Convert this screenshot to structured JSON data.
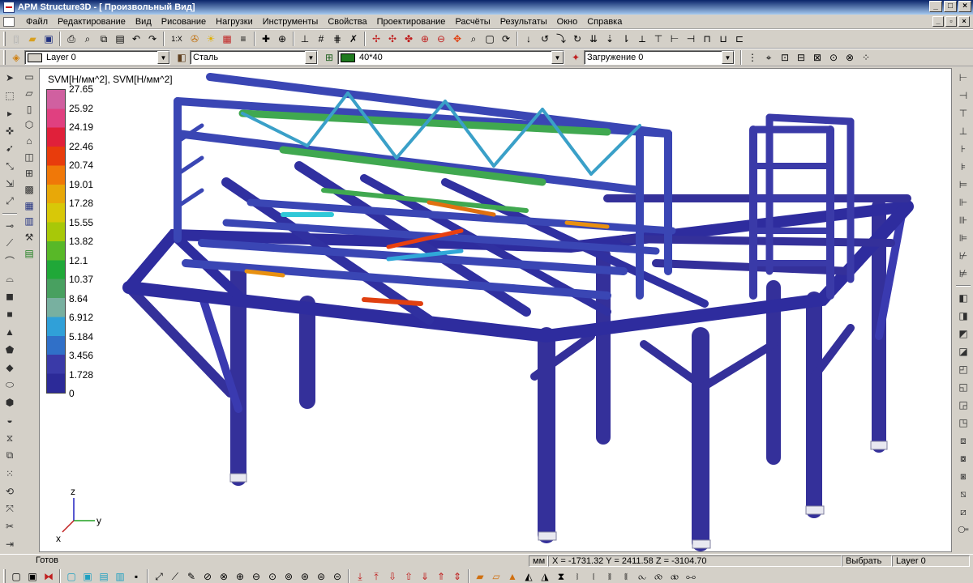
{
  "window": {
    "title": "APM Structure3D - [ Произвольный Вид]",
    "min": "_",
    "max": "□",
    "close": "×"
  },
  "menu": [
    "Файл",
    "Редактирование",
    "Вид",
    "Рисование",
    "Нагрузки",
    "Инструменты",
    "Свойства",
    "Проектирование",
    "Расчёты",
    "Результаты",
    "Окно",
    "Справка"
  ],
  "toolbar1": {
    "scale_label": "1:X"
  },
  "toolbar2": {
    "layer": {
      "value": "Layer 0",
      "color": "#d4d0c8"
    },
    "material": {
      "value": "Сталь"
    },
    "section": {
      "value": "40*40",
      "color": "#1f7a1f"
    },
    "loadcase": {
      "value": "Загружение 0"
    }
  },
  "legend": {
    "title": "SVM[Н/мм^2], SVM[Н/мм^2]",
    "values": [
      "27.65",
      "25.92",
      "24.19",
      "22.46",
      "20.74",
      "19.01",
      "17.28",
      "15.55",
      "13.82",
      "12.1",
      "10.37",
      "8.64",
      "6.912",
      "5.184",
      "3.456",
      "1.728",
      "0"
    ],
    "colors": [
      "#d060a0",
      "#e04080",
      "#e0203a",
      "#e83c0c",
      "#f07808",
      "#e8a808",
      "#d8c808",
      "#a8c808",
      "#58b828",
      "#20a838",
      "#48a060",
      "#78b0a0",
      "#30a0d8",
      "#3070c8",
      "#3a3aa8",
      "#2c2a98"
    ]
  },
  "axes": {
    "z": "z",
    "y": "y",
    "x": "x"
  },
  "status": {
    "ready": "Готов",
    "units": "мм",
    "coords": "X = -1731.32 Y = 2411.58 Z = -3104.70",
    "mode": "Выбрать",
    "layer": "Layer 0"
  }
}
